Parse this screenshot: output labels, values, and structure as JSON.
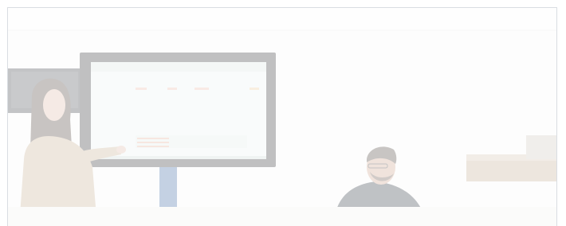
{
  "image": {
    "alt": "",
    "overlay_color": "#ffffff",
    "scene_colors": {
      "wall": "#f7f7f6",
      "ceiling": "#fbfbfb",
      "monitor_bezel": "#1d1f23",
      "monitor_screen": "#e8f0ef",
      "stand": "#2c5b9a",
      "presenter_hair": "#3c2c24",
      "presenter_clothes": "#c3a889",
      "man_jacket": "#1c2431",
      "man_skin": "#c99b82",
      "shelf": "#bda58a"
    }
  }
}
